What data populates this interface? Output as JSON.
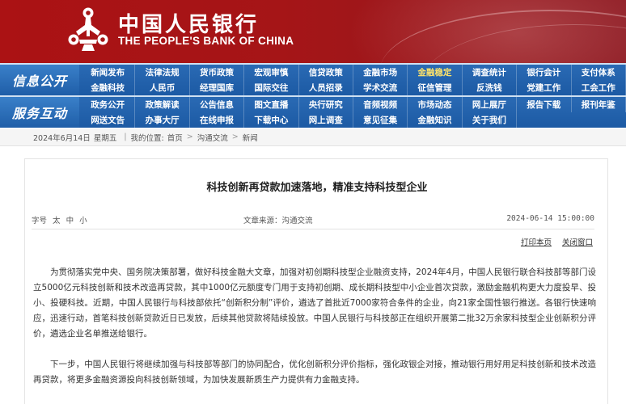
{
  "header": {
    "cn_name": "中国人民银行",
    "en_name": "THE PEOPLE'S BANK OF CHINA",
    "brand_color": "#a51517",
    "logo_icon": "pboc-emblem-icon"
  },
  "nav": {
    "sections": [
      {
        "label": "信息公开",
        "rows": [
          [
            "新闻发布",
            "法律法规",
            "货币政策",
            "宏观审慎",
            "信贷政策",
            "金融市场",
            "金融稳定",
            "调查统计",
            "银行会计",
            "支付体系"
          ],
          [
            "金融科技",
            "人民币",
            "经理国库",
            "国际交往",
            "人员招录",
            "学术交流",
            "征信管理",
            "反洗钱",
            "党建工作",
            "工会工作"
          ]
        ]
      },
      {
        "label": "服务互动",
        "rows": [
          [
            "政务公开",
            "政策解读",
            "公告信息",
            "图文直播",
            "央行研究",
            "音频视频",
            "市场动态",
            "网上展厅",
            "报告下载",
            "报刊年鉴"
          ],
          [
            "网送文告",
            "办事大厅",
            "在线申报",
            "下载中心",
            "网上调查",
            "意见征集",
            "金融知识",
            "关于我们"
          ]
        ]
      }
    ],
    "nav_color": "#1f5ea8"
  },
  "breadcrumb": {
    "date": "2024年6月14日",
    "weekday": "星期五",
    "location_label": "我的位置:",
    "items": [
      "首页",
      "沟通交流",
      "新闻"
    ]
  },
  "article": {
    "title": "科技创新再贷款加速落地，精准支持科技型企业",
    "font_size_label": "字号",
    "font_sizes": [
      "太",
      "中",
      "小"
    ],
    "source_label": "文章来源：",
    "source": "沟通交流",
    "datetime": "2024-06-14 15:00:00",
    "tools": [
      "打印本页",
      "关闭窗口"
    ],
    "paragraphs": [
      "为贯彻落实党中央、国务院决策部署，做好科技金融大文章，加强对初创期科技型企业融资支持，2024年4月，中国人民银行联合科技部等部门设立5000亿元科技创新和技术改造再贷款，其中1000亿元额度专门用于支持初创期、成长期科技型中小企业首次贷款，激励金融机构更大力度投早、投小、投硬科技。近期，中国人民银行与科技部依托“创新积分制”评价，遴选了首批近7000家符合条件的企业，向21家全国性银行推送。各银行快速响应，迅速行动，首笔科技创新贷款近日已发放，后续其他贷款将陆续投放。中国人民银行与科技部正在组织开展第二批32万余家科技型企业创新积分评价，遴选企业名单推送给银行。",
      "下一步，中国人民银行将继续加强与科技部等部门的协同配合，优化创新积分评价指标，强化政银企对接，推动银行用好用足科技创新和技术改造再贷款，将更多金融资源投向科技创新领域，为加快发展新质生产力提供有力金融支持。"
    ]
  }
}
